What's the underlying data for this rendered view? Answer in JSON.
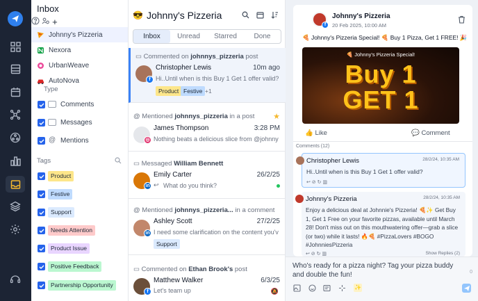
{
  "sidebar": {
    "title": "Inbox",
    "accounts": [
      {
        "label": "Johnny's Pizzeria",
        "color": "#d62828"
      },
      {
        "label": "Nexora",
        "color": "#16a34a"
      },
      {
        "label": "UrbanWeave",
        "color": "#ec4899"
      },
      {
        "label": "AutoNova",
        "color": "#dc2626"
      }
    ],
    "type_label": "Type",
    "types": [
      {
        "label": "Comments"
      },
      {
        "label": "Messages"
      },
      {
        "label": "Mentions"
      }
    ],
    "tags_label": "Tags",
    "tags": [
      {
        "label": "Product",
        "color": "#fde68a"
      },
      {
        "label": "Festive",
        "color": "#bfdbfe"
      },
      {
        "label": "Support",
        "color": "#dbeafe"
      },
      {
        "label": "Needs Attention",
        "color": "#fecaca"
      },
      {
        "label": "Product Issue",
        "color": "#e9d5ff"
      },
      {
        "label": "Positive Feedback",
        "color": "#bbf7d0"
      },
      {
        "label": "Partnership Opportunity",
        "color": "#bbf7d0"
      }
    ]
  },
  "list": {
    "title": "Johnny's Pizzeria",
    "tabs": [
      "Inbox",
      "Unread",
      "Starred",
      "Done"
    ],
    "conversations": [
      {
        "context_prefix": "Commented on",
        "context_bold": "johnnys_pizzeria",
        "context_suffix": "post",
        "name": "Christopher Lewis",
        "time": "10m ago",
        "preview": "Hi..Until when is this Buy 1 Get 1 offer valid?",
        "chips": [
          "Product",
          "Festive",
          "+1"
        ]
      },
      {
        "context_prefix": "Mentioned",
        "context_bold": "johnnys_pizzeria",
        "context_suffix": "in a post",
        "name": "James Thompson",
        "time": "3:28 PM",
        "preview": "Nothing beats a delicious slice from @johnnys_pizzeria"
      },
      {
        "context_prefix": "Messaged",
        "context_bold": "William Bennett",
        "context_suffix": "",
        "name": "Emily Carter",
        "time": "26/2/25",
        "preview": "What do you think?"
      },
      {
        "context_prefix": "Mentioned",
        "context_bold": "johnnys_pizzeria...",
        "context_suffix": "in a comment",
        "name": "Ashley Scott",
        "time": "27/2/25",
        "preview": "I need some clarification on the content you've uploaded...",
        "chips": [
          "Support"
        ]
      },
      {
        "context_prefix": "Commented on",
        "context_bold": "Ethan Brook's",
        "context_suffix": "post",
        "name": "Matthew Walker",
        "time": "6/3/25",
        "preview": "Let's team up"
      }
    ]
  },
  "post": {
    "author": "Johnny's Pizzeria",
    "date": "20 Feb 2025, 10:00 AM",
    "caption": "🍕 Johnny's Pizzeria Special! 🍕 Buy 1 Pizza, Get 1 FREE! 🎉",
    "image_banner": "🍕 Johnny's Pizzeria Special!",
    "image_line1": "Buy 1",
    "image_line2": "GET 1",
    "like_label": "Like",
    "comment_label": "Comment",
    "comments_header": "Comments (12)",
    "comments": [
      {
        "name": "Christopher Lewis",
        "time": "28/2/24, 10:35 AM",
        "text": "Hi..Until when is this Buy 1 Get 1 offer valid?"
      },
      {
        "name": "Johnny's Pizzeria",
        "time": "28/2/24, 10:35 AM",
        "text": "Enjoy a delicious deal at Johnnie's Pizzeria! 🍕✨ Get Buy 1, Get 1 Free on your favorite pizzas, available until March 28! Don't miss out on this mouthwatering offer—grab a slice (or two) while it lasts! 🔥🍕 #PizzaLovers #BOGO #JohnniesPizzeria",
        "footer": "Show Replies (2)"
      }
    ]
  },
  "reply": {
    "text": "Who's ready for a pizza night? Tag your pizza buddy and double the fun!",
    "counter": "0"
  },
  "colors": {
    "rail": "#1c2434",
    "accent": "#2563eb",
    "facebook": "#1877f2",
    "instagram": "#e1306c",
    "linkedin": "#0a66c2"
  }
}
